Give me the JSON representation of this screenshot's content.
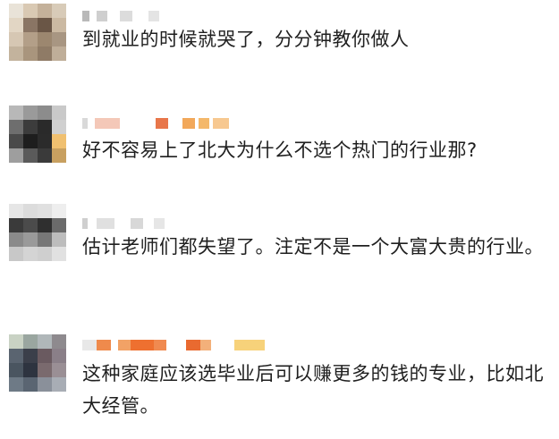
{
  "comments": [
    {
      "text": "到就业的时候就哭了，分分钟教你做人",
      "avatar_colors": [
        "#e9e3d8",
        "#d9c9b3",
        "#c4b19a",
        "#d8cbb8",
        "#e2d6c4",
        "#8a7564",
        "#6a5646",
        "#cbb9a2",
        "#d6c7b3",
        "#b39f88",
        "#9c876f",
        "#a89682",
        "#c3b39d",
        "#a9957d",
        "#8f7b66",
        "#bfae99"
      ],
      "name_blocks": [
        [
          "#b9b9b9",
          8
        ],
        [
          "#ffffff",
          8
        ],
        [
          "#cfcfcf",
          12
        ],
        [
          "#ffffff",
          14
        ],
        [
          "#dcdcdc",
          14
        ],
        [
          "#ffffff",
          18
        ],
        [
          "#e4e4e4",
          12
        ]
      ]
    },
    {
      "text": "好不容易上了北大为什么不选个热门的行业那?",
      "avatar_colors": [
        "#b8b8b8",
        "#9a9a9a",
        "#8c8c8c",
        "#c9c9c9",
        "#6e6e6e",
        "#3c3c3c",
        "#2a2a2a",
        "#d0d0d0",
        "#4a4a4a",
        "#1e1e1e",
        "#2b2b2b",
        "#f0c070",
        "#9e9e9e",
        "#5a5a5a",
        "#3a3a3a",
        "#c8a060"
      ],
      "name_blocks": [
        [
          "#d9d9d9",
          6
        ],
        [
          "#ffffff",
          8
        ],
        [
          "#f4c8b8",
          28
        ],
        [
          "#ffffff",
          40
        ],
        [
          "#e8764a",
          14
        ],
        [
          "#ffffff",
          16
        ],
        [
          "#f2a85a",
          14
        ],
        [
          "#ffffff",
          4
        ],
        [
          "#f4b86a",
          12
        ],
        [
          "#ffffff",
          4
        ],
        [
          "#f7c890",
          18
        ]
      ]
    },
    {
      "text": "估计老师们都失望了。注定不是一个大富大贵的行业。",
      "avatar_colors": [
        "#e6e6e6",
        "#dcdcdc",
        "#e0e0e0",
        "#eeeeee",
        "#3a3a3a",
        "#4b4b4b",
        "#2f2f2f",
        "#6b6b6b",
        "#8a8a8a",
        "#9a9a9a",
        "#777777",
        "#bdbdbd",
        "#c8c8c8",
        "#d4d4d4",
        "#cfcfcf",
        "#e1e1e1"
      ],
      "name_blocks": [
        [
          "#cfcfcf",
          6
        ],
        [
          "#ffffff",
          10
        ],
        [
          "#e0e0e0",
          20
        ],
        [
          "#ffffff",
          18
        ],
        [
          "#d8d8d8",
          14
        ],
        [
          "#ffffff",
          12
        ],
        [
          "#e6e6e6",
          12
        ]
      ]
    },
    {
      "text": "这种家庭应该选毕业后可以赚更多的钱的专业，比如北大经管。",
      "avatar_colors": [
        "#c9d2c4",
        "#9aa6a0",
        "#b0b7b9",
        "#8e8a8e",
        "#5a6470",
        "#3b3f4a",
        "#6a5a60",
        "#8a7f88",
        "#4a5560",
        "#2e3440",
        "#7a6a6e",
        "#9a8f95",
        "#6e7a86",
        "#5a6572",
        "#8a909a",
        "#a8adb5"
      ],
      "name_blocks": [
        [
          "#e8e8e8",
          16
        ],
        [
          "#ef8a4c",
          16
        ],
        [
          "#ffffff",
          8
        ],
        [
          "#f2a266",
          14
        ],
        [
          "#ee7030",
          26
        ],
        [
          "#f08a50",
          14
        ],
        [
          "#ffffff",
          22
        ],
        [
          "#e96a30",
          16
        ],
        [
          "#f3b07a",
          12
        ],
        [
          "#ffffff",
          26
        ],
        [
          "#f7d27a",
          34
        ]
      ]
    }
  ]
}
